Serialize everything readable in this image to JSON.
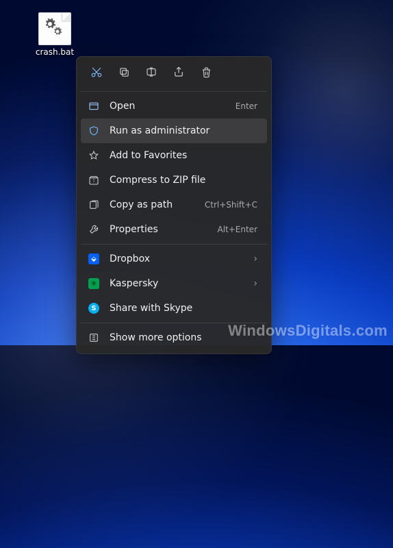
{
  "desktop": {
    "icon": {
      "label": "crash.bat"
    }
  },
  "context_menu": {
    "top_actions": [
      {
        "name": "cut-icon"
      },
      {
        "name": "copy-icon"
      },
      {
        "name": "rename-icon"
      },
      {
        "name": "share-icon"
      },
      {
        "name": "delete-icon"
      }
    ],
    "items": [
      {
        "icon": "window-icon",
        "label": "Open",
        "accel": "Enter"
      },
      {
        "icon": "shield-icon",
        "label": "Run as administrator",
        "accel": "",
        "hovered": true
      },
      {
        "icon": "star-icon",
        "label": "Add to Favorites",
        "accel": ""
      },
      {
        "icon": "zip-icon",
        "label": "Compress to ZIP file",
        "accel": ""
      },
      {
        "icon": "copy-path-icon",
        "label": "Copy as path",
        "accel": "Ctrl+Shift+C"
      },
      {
        "icon": "wrench-icon",
        "label": "Properties",
        "accel": "Alt+Enter"
      }
    ],
    "apps": [
      {
        "icon": "dropbox-icon",
        "label": "Dropbox",
        "submenu": true
      },
      {
        "icon": "kaspersky-icon",
        "label": "Kaspersky",
        "submenu": true
      },
      {
        "icon": "skype-icon",
        "label": "Share with Skype",
        "submenu": false
      }
    ],
    "more": {
      "icon": "more-icon",
      "label": "Show more options"
    }
  },
  "watermark": "WindowsDigitals.com"
}
